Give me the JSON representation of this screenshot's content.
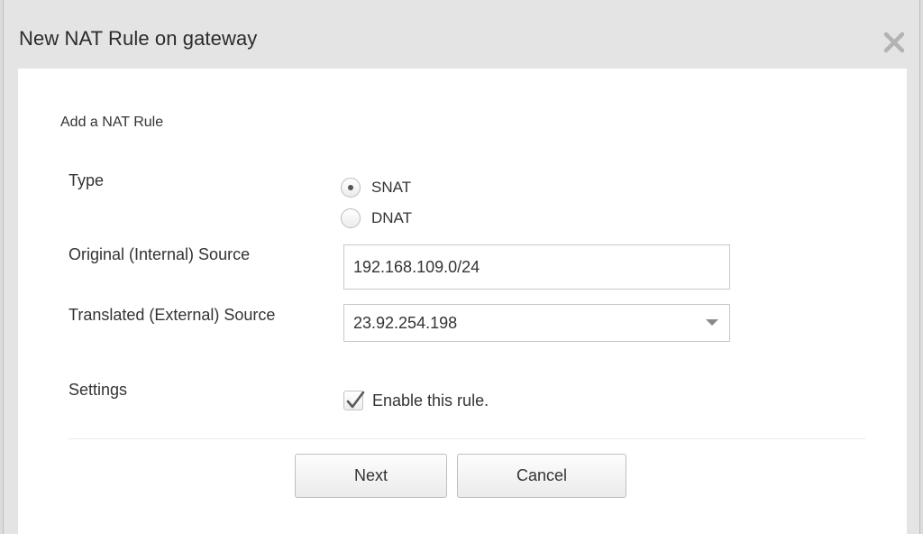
{
  "dialog": {
    "title": "New NAT Rule on gateway",
    "close_icon": "close-icon"
  },
  "form": {
    "section_title": "Add a NAT Rule",
    "type": {
      "label": "Type",
      "options": [
        {
          "label": "SNAT",
          "selected": true
        },
        {
          "label": "DNAT",
          "selected": false
        }
      ]
    },
    "original_source": {
      "label": "Original (Internal) Source",
      "value": "192.168.109.0/24"
    },
    "translated_source": {
      "label": "Translated (External) Source",
      "value": "23.92.254.198"
    },
    "settings": {
      "label": "Settings",
      "enable_rule_label": "Enable this rule.",
      "enable_rule_checked": true
    }
  },
  "buttons": {
    "next": "Next",
    "cancel": "Cancel"
  }
}
